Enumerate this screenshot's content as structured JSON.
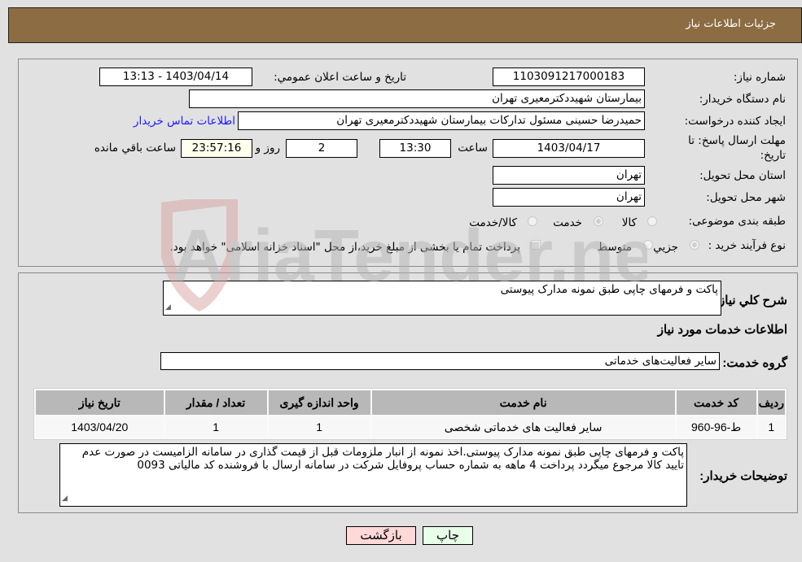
{
  "header": {
    "title": "جزئيات اطلاعات نياز"
  },
  "details": {
    "need_number_label": "شماره نياز:",
    "need_number": "1103091217000183",
    "announce_label": "تاريخ و ساعت اعلان عمومي:",
    "announce_value": "1403/04/14 - 13:13",
    "buyer_org_label": "نام دستگاه خريدار:",
    "buyer_org": "بيمارستان شهيددكترمعيری تهران",
    "requester_label": "ايجاد کننده درخواست:",
    "requester": "حميدرضا حسينی مسئول تدارکات بيمارستان شهيددکترمعيری تهران",
    "contact_link": "اطلاعات تماس خريدار",
    "deadline_label": "مهلت ارسال پاسخ: تا تاريخ:",
    "deadline_date": "1403/04/17",
    "time_label": "ساعت",
    "deadline_time": "13:30",
    "days_value": "2",
    "days_label": "روز و",
    "remaining_time": "23:57:16",
    "remaining_label": "ساعت باقي مانده",
    "province_label": "استان محل تحويل:",
    "province": "تهران",
    "city_label": "شهر محل تحويل:",
    "city": "تهران",
    "category_label": "طبقه بندی موضوعی:",
    "category_options": [
      {
        "label": "کالا",
        "selected": false
      },
      {
        "label": "خدمت",
        "selected": true
      },
      {
        "label": "کالا/خدمت",
        "selected": false
      }
    ],
    "process_label": "نوع فرآيند خريد :",
    "process_options": [
      {
        "label": "جزيي",
        "selected": true
      },
      {
        "label": "متوسط",
        "selected": false
      }
    ],
    "treasury_note": "پرداخت تمام يا بخشی از مبلغ خريد،از محل \"اسناد خزانه اسلامی\" خواهد بود.",
    "treasury_checked": false
  },
  "services": {
    "summary_label": "شرح کلي نياز:",
    "summary": "پاکت و فرمهای چاپی طبق نمونه مدارک پيوستی",
    "section_title": "اطلاعات خدمات مورد نياز",
    "group_label": "گروه خدمت:",
    "group_value": "ساير فعاليت‌های خدماتی",
    "table": {
      "headers": [
        "رديف",
        "کد خدمت",
        "نام خدمت",
        "واحد اندازه گيری",
        "تعداد / مقدار",
        "تاريخ نياز"
      ],
      "rows": [
        [
          "1",
          "ط-96-960",
          "ساير فعاليت های خدماتی شخصی",
          "1",
          "1",
          "1403/04/20"
        ]
      ]
    },
    "buyer_notes_label": "توضيحات خريدار:",
    "buyer_notes": "پاکت و فرمهای چاپی طبق نمونه مدارک پيوستی.اخذ نمونه از انبار ملزومات قبل از قيمت گذاری در سامانه الزاميست در صورت عدم تاييد کالا مرجوع ميگردد پرداخت 4 ماهه به شماره حساب پروفايل شرکت در سامانه ارسال با فروشنده کد مالياتی 0093"
  },
  "buttons": {
    "back": "بازگشت",
    "print": "چاپ"
  },
  "watermark": {
    "text": "AriaTender.neT"
  }
}
